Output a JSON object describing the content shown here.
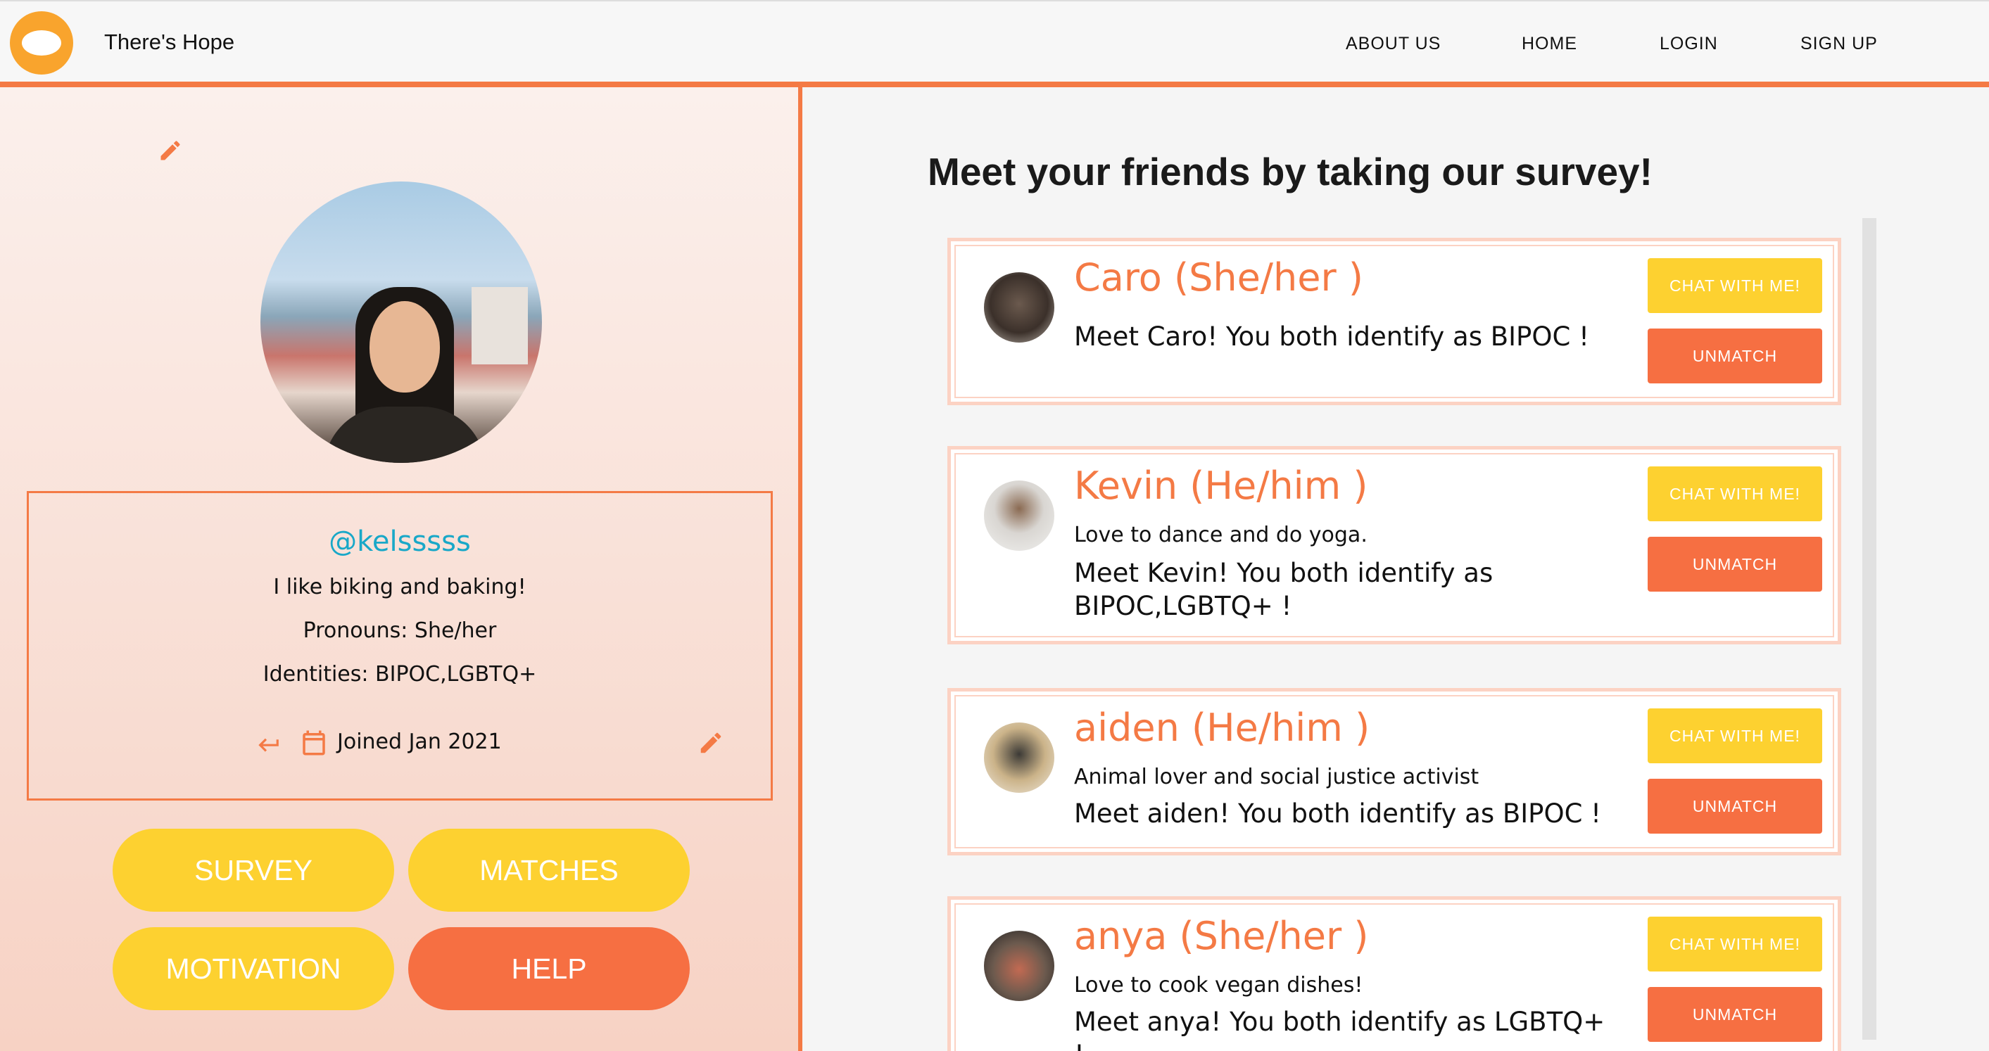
{
  "header": {
    "brand": "There's Hope",
    "nav": [
      "ABOUT US",
      "HOME",
      "LOGIN",
      "SIGN UP"
    ]
  },
  "profile": {
    "username": "@kelsssss",
    "bio": "I like biking and baking!",
    "pronouns": "Pronouns: She/her",
    "identities": "Identities: BIPOC,LGBTQ+",
    "joined": "Joined Jan 2021"
  },
  "sidebar_buttons": {
    "survey": "SURVEY",
    "matches": "MATCHES",
    "motivation": "MOTIVATION",
    "help": "HELP"
  },
  "main": {
    "title": "Meet your friends by taking our survey!"
  },
  "matches": [
    {
      "name": "Caro (She/her )",
      "bio": "",
      "meet": "Meet Caro! You both identify as BIPOC !",
      "chat_label": "CHAT WITH ME!",
      "unmatch_label": "UNMATCH"
    },
    {
      "name": "Kevin (He/him )",
      "bio": "Love to dance and do yoga.",
      "meet": "Meet Kevin! You both identify as BIPOC,LGBTQ+ !",
      "chat_label": "CHAT WITH ME!",
      "unmatch_label": "UNMATCH"
    },
    {
      "name": "aiden (He/him )",
      "bio": "Animal lover and social justice activist",
      "meet": "Meet aiden! You both identify as BIPOC !",
      "chat_label": "CHAT WITH ME!",
      "unmatch_label": "UNMATCH"
    },
    {
      "name": "anya (She/her )",
      "bio": "Love to cook vegan dishes!",
      "meet": "Meet anya! You both identify as LGBTQ+ !",
      "chat_label": "CHAT WITH ME!",
      "unmatch_label": "UNMATCH"
    }
  ],
  "colors": {
    "accent": "#f47a45",
    "yellow": "#fdd130",
    "orange": "#f66f42",
    "username": "#19a8c8"
  },
  "icons": [
    "logo-icon",
    "pencil-icon",
    "return-arrow-icon",
    "calendar-icon"
  ]
}
